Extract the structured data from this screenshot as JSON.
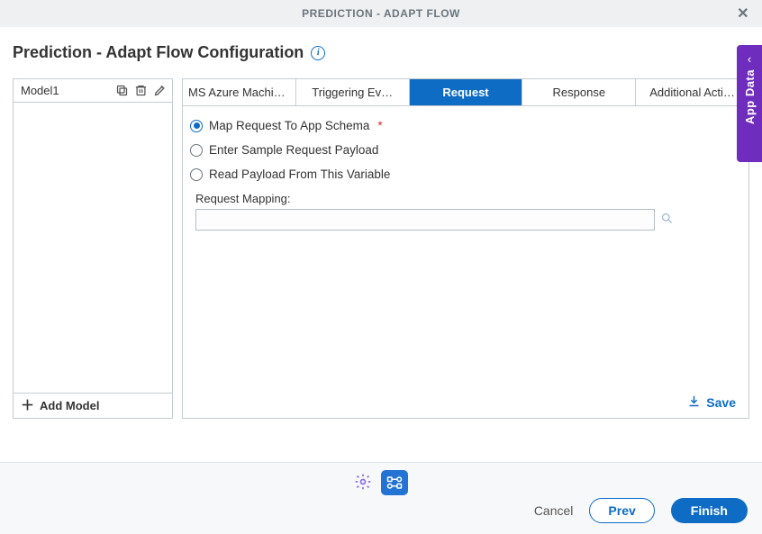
{
  "header": {
    "title": "PREDICTION - ADAPT FLOW"
  },
  "page_title": "Prediction - Adapt Flow Configuration",
  "sidebar": {
    "models": [
      "Model1"
    ],
    "add_label": "Add Model"
  },
  "tabs": [
    {
      "label": "MS Azure Machine Lear…",
      "active": false
    },
    {
      "label": "Triggering Ev…",
      "active": false
    },
    {
      "label": "Request",
      "active": true
    },
    {
      "label": "Response",
      "active": false
    },
    {
      "label": "Additional Acti…",
      "active": false
    }
  ],
  "request_panel": {
    "options": [
      {
        "label": "Map Request To App Schema",
        "selected": true,
        "required": true
      },
      {
        "label": "Enter Sample Request Payload",
        "selected": false,
        "required": false
      },
      {
        "label": "Read Payload From This Variable",
        "selected": false,
        "required": false
      }
    ],
    "mapping_label": "Request Mapping:",
    "mapping_value": "",
    "save_label": "Save"
  },
  "side_handle": {
    "label": "App Data"
  },
  "footer": {
    "cancel": "Cancel",
    "prev": "Prev",
    "finish": "Finish"
  },
  "colors": {
    "primary": "#0e6cc5",
    "purple": "#6f2dbd"
  }
}
